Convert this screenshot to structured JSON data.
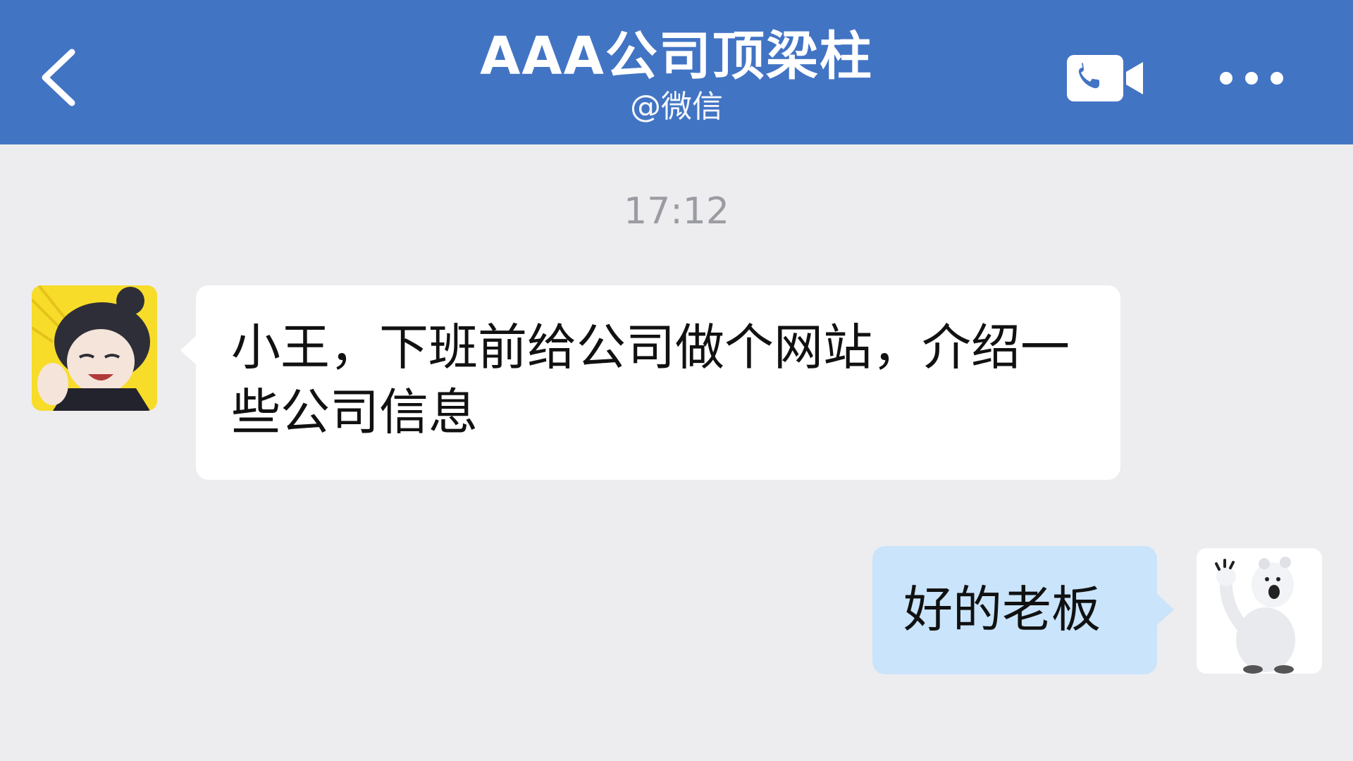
{
  "header": {
    "title": "AAA公司顶梁柱",
    "subtitle": "@微信",
    "back_icon": "chevron-left-icon",
    "call_icon": "video-call-icon",
    "more_icon": "more-dots-icon",
    "background_color": "#4274c4"
  },
  "conversation": {
    "timestamp": "17:12",
    "messages": [
      {
        "direction": "incoming",
        "avatar": "anime-character-avatar",
        "text": "小王，下班前给公司做个网站，介绍一些公司信息",
        "bubble_color": "#ffffff"
      },
      {
        "direction": "outgoing",
        "avatar": "polar-bear-avatar",
        "text": "好的老板",
        "bubble_color": "#c9e4fb"
      }
    ]
  }
}
